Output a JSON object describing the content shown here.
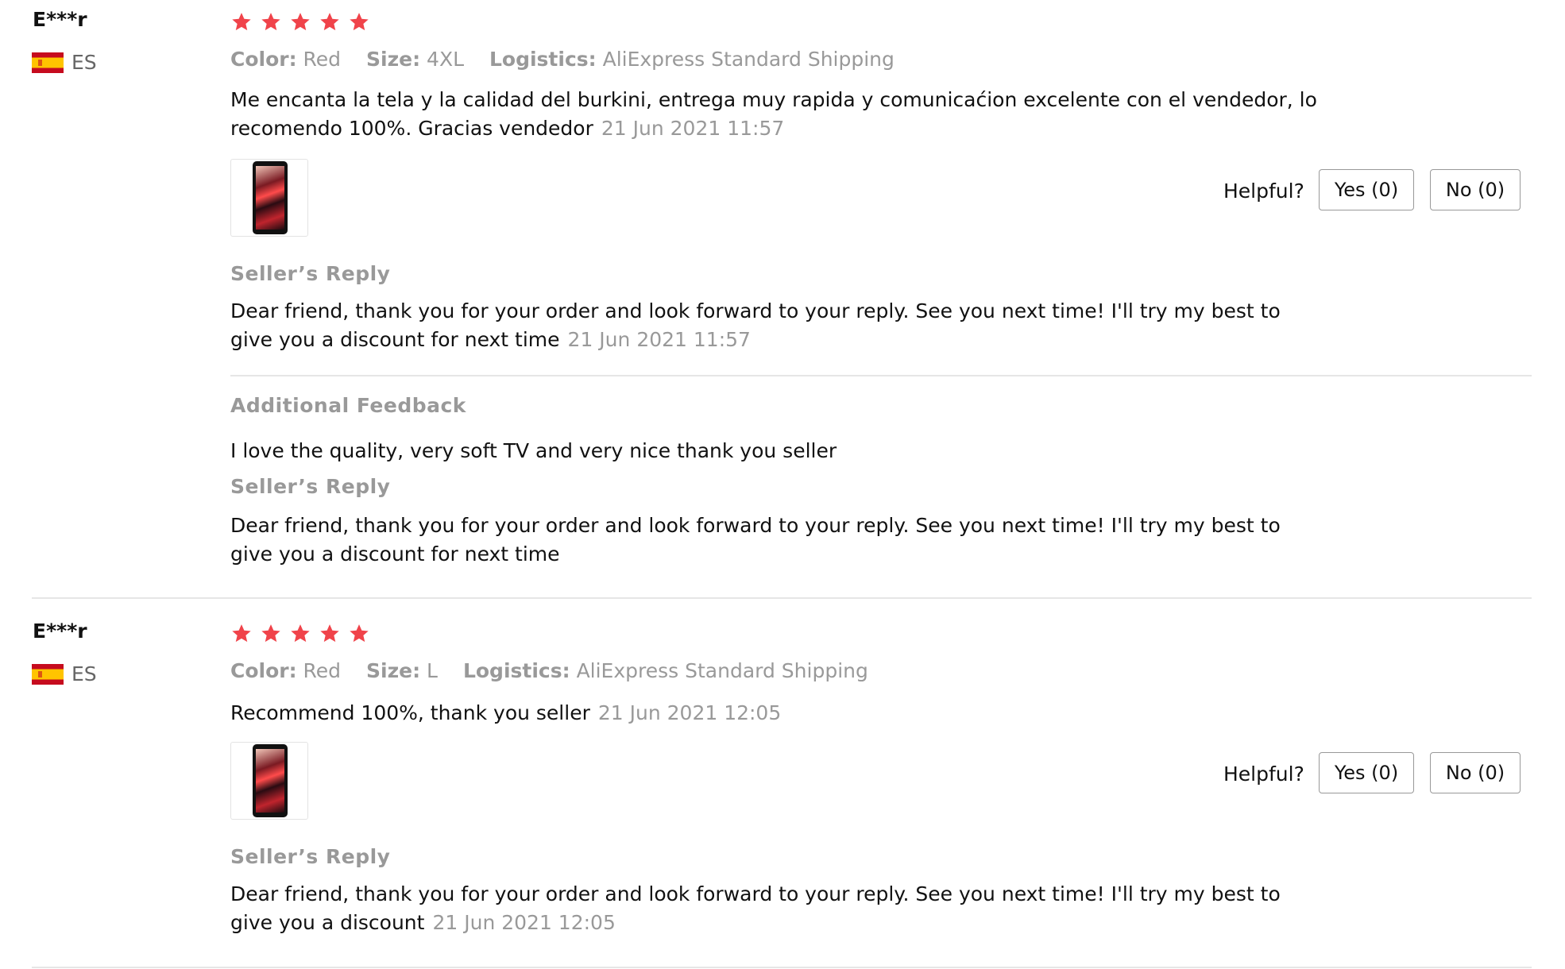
{
  "reviews": [
    {
      "user": "E***r",
      "country": "ES",
      "rating": 5,
      "meta": {
        "color_label": "Color:",
        "color": "Red",
        "size_label": "Size:",
        "size": "4XL",
        "logistics_label": "Logistics:",
        "logistics": "AliExpress Standard Shipping"
      },
      "text": "Me encanta la tela y la calidad del burkini, entrega muy rapida y comunicaćion excelente con el vendedor, lo recomendo 100%. Gracias vendedor",
      "date": "21 Jun 2021 11:57",
      "helpful_label": "Helpful?",
      "yes_label": "Yes (0)",
      "no_label": "No (0)",
      "seller_reply_title": "Seller’s Reply",
      "seller_reply": "Dear friend, thank you for your order and look forward to your reply. See you next time! I'll try my best to give you a discount for next time",
      "seller_reply_date": "21 Jun 2021 11:57",
      "additional_title": "Additional Feedback",
      "additional_text": "I love the quality, very soft TV and very nice thank you seller",
      "additional_reply_title": "Seller’s Reply",
      "additional_reply": "Dear friend, thank you for your order and look forward to your reply. See you next time! I'll try my best to give you a discount for next time"
    },
    {
      "user": "E***r",
      "country": "ES",
      "rating": 5,
      "meta": {
        "color_label": "Color:",
        "color": "Red",
        "size_label": "Size:",
        "size": "L",
        "logistics_label": "Logistics:",
        "logistics": "AliExpress Standard Shipping"
      },
      "text": "Recommend 100%, thank you seller",
      "date": "21 Jun 2021 12:05",
      "helpful_label": "Helpful?",
      "yes_label": "Yes (0)",
      "no_label": "No (0)",
      "seller_reply_title": "Seller’s Reply",
      "seller_reply": "Dear friend, thank you for your order and look forward to your reply. See you next time! I'll try my best to give you a discount",
      "seller_reply_date": "21 Jun 2021 12:05"
    }
  ],
  "colors": {
    "star": "#f0434a",
    "muted": "#999999",
    "text": "#111111",
    "divider": "#e6e6e6"
  },
  "icons": {
    "star": "star-icon",
    "flag": "spain-flag-icon",
    "thumbnail": "review-photo-thumbnail"
  }
}
